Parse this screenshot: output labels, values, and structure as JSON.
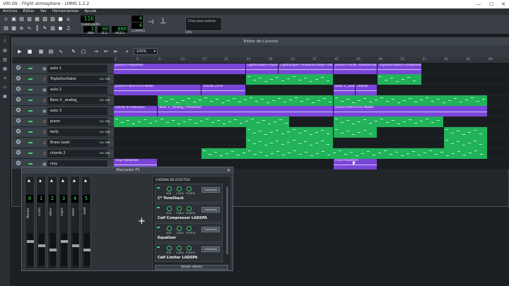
{
  "window": {
    "title": "Vitt-Ok - Flight atmosphere - LMMS 1.2.2",
    "minimize": "—",
    "maximize": "☐",
    "close": "✕"
  },
  "menu": [
    "Archivo",
    "Editar",
    "Ver",
    "Herramientas",
    "Ayuda"
  ],
  "transport": {
    "tempo_value": "116",
    "tempo_label": "TEMPO/BPM",
    "min_value": "1",
    "min_label": "MIN",
    "sec_value": "00",
    "sec_label": "SEG",
    "msec_value": "000",
    "msec_label": "MSEG",
    "comp_top": "4",
    "comp_bottom": "4",
    "comp_label": "COMPÁS",
    "cpu_hint": "Click para activar",
    "cpu_label": "CPU"
  },
  "song_editor": {
    "title": "Editor de Canción",
    "zoom": "100%",
    "ruler": [
      "1",
      "5",
      "9",
      "13",
      "17",
      "21",
      "25",
      "29",
      "33",
      "37",
      "41",
      "45",
      "49",
      "53",
      "57",
      "61",
      "65",
      "69"
    ]
  },
  "tracks": [
    {
      "name": "auto 1",
      "icon": "automation-icon",
      "type": "auto",
      "vp": false
    },
    {
      "name": "TripleOscillator",
      "icon": "instrument-icon",
      "type": "inst",
      "vp": true
    },
    {
      "name": "auto 2",
      "icon": "automation-icon",
      "type": "auto",
      "vp": false
    },
    {
      "name": "Bass 3 _analog_",
      "icon": "instrument-icon",
      "type": "inst",
      "vp": true
    },
    {
      "name": "auto 3",
      "icon": "automation-icon",
      "type": "auto",
      "vp": false
    },
    {
      "name": "piano",
      "icon": "instrument-icon",
      "type": "inst",
      "vp": true
    },
    {
      "name": "belly",
      "icon": "instrument-icon",
      "type": "inst",
      "vp": true
    },
    {
      "name": "Brass Lead",
      "icon": "instrument-icon",
      "type": "inst",
      "vp": true
    },
    {
      "name": "chords 2",
      "icon": "instrument-icon",
      "type": "inst",
      "vp": true
    },
    {
      "name": "rssy",
      "icon": "automation-icon",
      "type": "auto",
      "vp": false
    }
  ],
  "vp_label": "VOL PAN",
  "clips": [
    {
      "row": 0,
      "start": 1,
      "end": 25,
      "c": "p",
      "label": "piano>>Volumen"
    },
    {
      "row": 0,
      "start": 25,
      "end": 31,
      "c": "p",
      "label": "LightDroper>TripleOscillator"
    },
    {
      "row": 0,
      "start": 31,
      "end": 41,
      "c": "p",
      "label": "LightDroper>TripleOscillator>Otrabanda"
    },
    {
      "row": 0,
      "start": 41,
      "end": 49,
      "c": "p",
      "label": "piano>Tromb TripleOscillator"
    },
    {
      "row": 0,
      "start": 49,
      "end": 57,
      "c": "p",
      "label": "TripleOscillator>Otrabanda"
    },
    {
      "row": 1,
      "start": 25,
      "end": 41,
      "c": "g",
      "label": ""
    },
    {
      "row": 1,
      "start": 49,
      "end": 57,
      "c": "g",
      "label": ""
    },
    {
      "row": 2,
      "start": 1,
      "end": 17,
      "c": "p",
      "label": "piano>Filtro>Fre>Notas"
    },
    {
      "row": 2,
      "start": 17,
      "end": 25,
      "c": "p",
      "label": "chords 2>Fil"
    },
    {
      "row": 2,
      "start": 41,
      "end": 45,
      "c": "p",
      "label": "Bass 3 _anal"
    },
    {
      "row": 2,
      "start": 45,
      "end": 49,
      "c": "p",
      "label": "chords"
    },
    {
      "row": 3,
      "start": 9,
      "end": 41,
      "c": "g",
      "label": ""
    },
    {
      "row": 3,
      "start": 41,
      "end": 69,
      "c": "g",
      "label": ""
    },
    {
      "row": 4,
      "start": 1,
      "end": 9,
      "c": "p",
      "label": "Efecto 4>Volumen"
    },
    {
      "row": 4,
      "start": 9,
      "end": 41,
      "c": "p",
      "label": "Bass 3 _analog_>Volumen"
    },
    {
      "row": 4,
      "start": 41,
      "end": 69,
      "c": "p",
      "label": "piano>Filtro>Fre>Notas"
    },
    {
      "row": 5,
      "start": 1,
      "end": 33,
      "c": "g",
      "label": ""
    },
    {
      "row": 5,
      "start": 41,
      "end": 61,
      "c": "g",
      "label": ""
    },
    {
      "row": 6,
      "start": 25,
      "end": 41,
      "c": "g",
      "label": ""
    },
    {
      "row": 6,
      "start": 41,
      "end": 49,
      "c": "g",
      "label": ""
    },
    {
      "row": 6,
      "start": 61,
      "end": 69,
      "c": "g",
      "label": ""
    },
    {
      "row": 7,
      "start": 25,
      "end": 41,
      "c": "g",
      "label": ""
    },
    {
      "row": 7,
      "start": 61,
      "end": 69,
      "c": "g",
      "label": ""
    },
    {
      "row": 8,
      "start": 17,
      "end": 69,
      "c": "g",
      "label": ""
    },
    {
      "row": 9,
      "start": 1,
      "end": 9,
      "c": "p",
      "label": "rssy>Volumen"
    },
    {
      "row": 9,
      "start": 41,
      "end": 49,
      "c": "p",
      "label": "rssy>Volumen"
    }
  ],
  "fx_mixer": {
    "title": "Mezclador FX",
    "channels": [
      {
        "num": "0",
        "name": "Master"
      },
      {
        "num": "1",
        "name": "crash"
      },
      {
        "num": "2",
        "name": "other"
      },
      {
        "num": "3",
        "name": "triple"
      },
      {
        "num": "4",
        "name": "other"
      },
      {
        "num": "5",
        "name": "lead"
      }
    ],
    "chain_title": "CADENA DE EFECTOS",
    "effects": [
      {
        "name": "C* ToneStack",
        "knobs": [
          "W/D",
          "CAÍDA",
          "PUERTA"
        ],
        "control": "Controles"
      },
      {
        "name": "Calf Compressor LADSPA",
        "knobs": [
          "W/D",
          "CAÍDA",
          "PUERTA"
        ],
        "control": "Controles"
      },
      {
        "name": "Equalizer",
        "knobs": [
          "W/D",
          "CAÍDA",
          "PUERTA"
        ],
        "control": "Controles"
      },
      {
        "name": "Calf Limiter LADSPA",
        "knobs": [
          "W/D",
          "CAÍDA",
          "PUERTA"
        ],
        "control": "Controles"
      }
    ],
    "add_effect": "Añadir efecto"
  }
}
